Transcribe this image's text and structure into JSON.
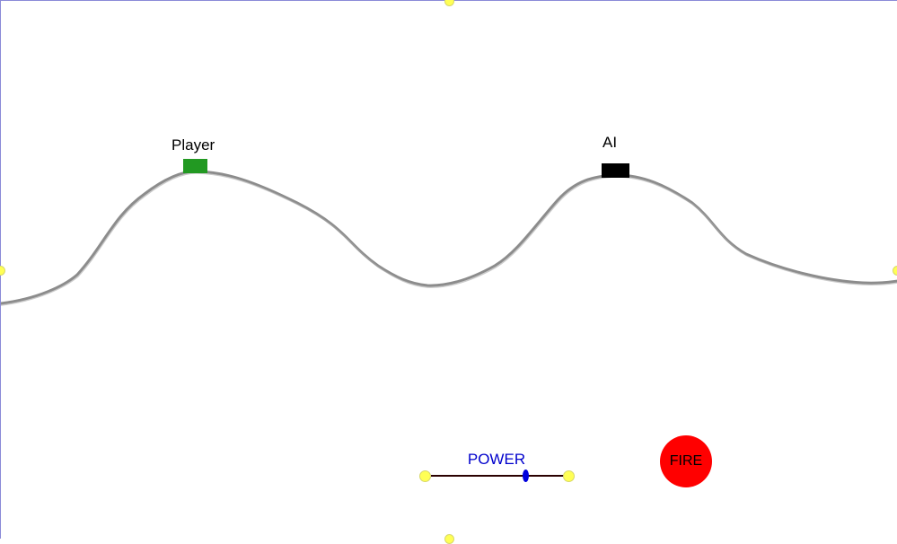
{
  "players": {
    "player": {
      "label": "Player",
      "color": "#229922"
    },
    "ai": {
      "label": "AI",
      "color": "#000000"
    }
  },
  "terrain": {
    "color": "#8c8c8c"
  },
  "power": {
    "label": "POWER",
    "value": 0.71,
    "track_color": "#2a0000",
    "knob_color": "#0000dd",
    "label_color": "#0000cc"
  },
  "fire_button": {
    "label": "FIRE",
    "color": "#ff0000"
  },
  "handles": {
    "color": "#ffff55"
  }
}
